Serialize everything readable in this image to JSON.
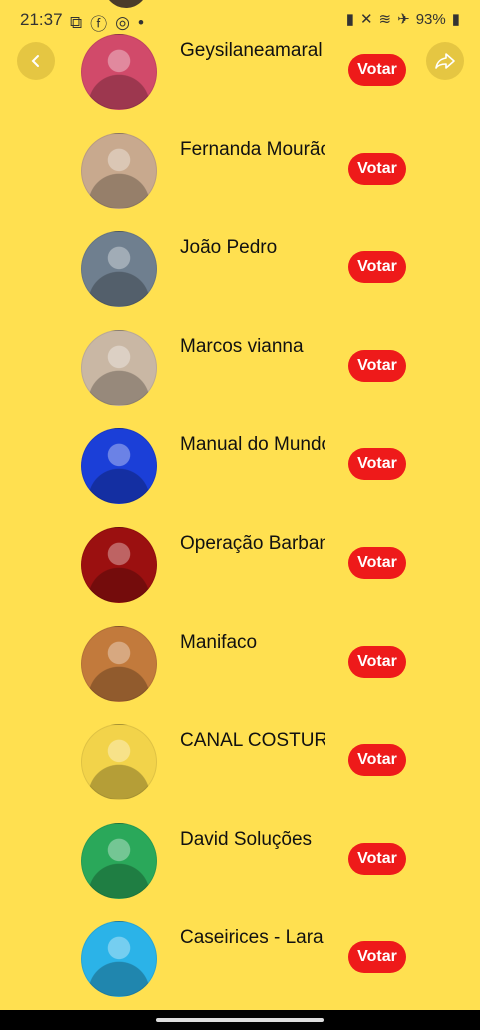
{
  "status": {
    "time": "21:37",
    "battery": "93%"
  },
  "nav": {
    "back_icon": "chevron-left-icon",
    "share_icon": "share-arrow-icon"
  },
  "vote_label": "Votar",
  "items": [
    {
      "name": "Geysilaneamaral",
      "avatar": "woman-red-top",
      "color": "#d14a6a"
    },
    {
      "name": "Fernanda Mourão",
      "avatar": "woman-selfie",
      "color": "#c8a98e"
    },
    {
      "name": "João Pedro",
      "avatar": "man-eating",
      "color": "#6f7f8f"
    },
    {
      "name": "Marcos vianna",
      "avatar": "man-white-tee",
      "color": "#c9b7a4"
    },
    {
      "name": "Manual do Mundo",
      "avatar": "letter-m-logo",
      "color": "#1b3fd8"
    },
    {
      "name": "Operação Barbante",
      "avatar": "bearded-man-logo",
      "color": "#9b1010"
    },
    {
      "name": "Manifaco",
      "avatar": "manifaco-logo",
      "color": "#c27a3c"
    },
    {
      "name": "CANAL COSTURA POR AMOR",
      "avatar": "costura-por-amor-logo",
      "color": "#f2d34a"
    },
    {
      "name": "David Soluções",
      "avatar": "man-green-background",
      "color": "#2aa85a"
    },
    {
      "name": "Caseirices - Lara",
      "avatar": "woman-blue-background",
      "color": "#2bb3e8"
    }
  ]
}
